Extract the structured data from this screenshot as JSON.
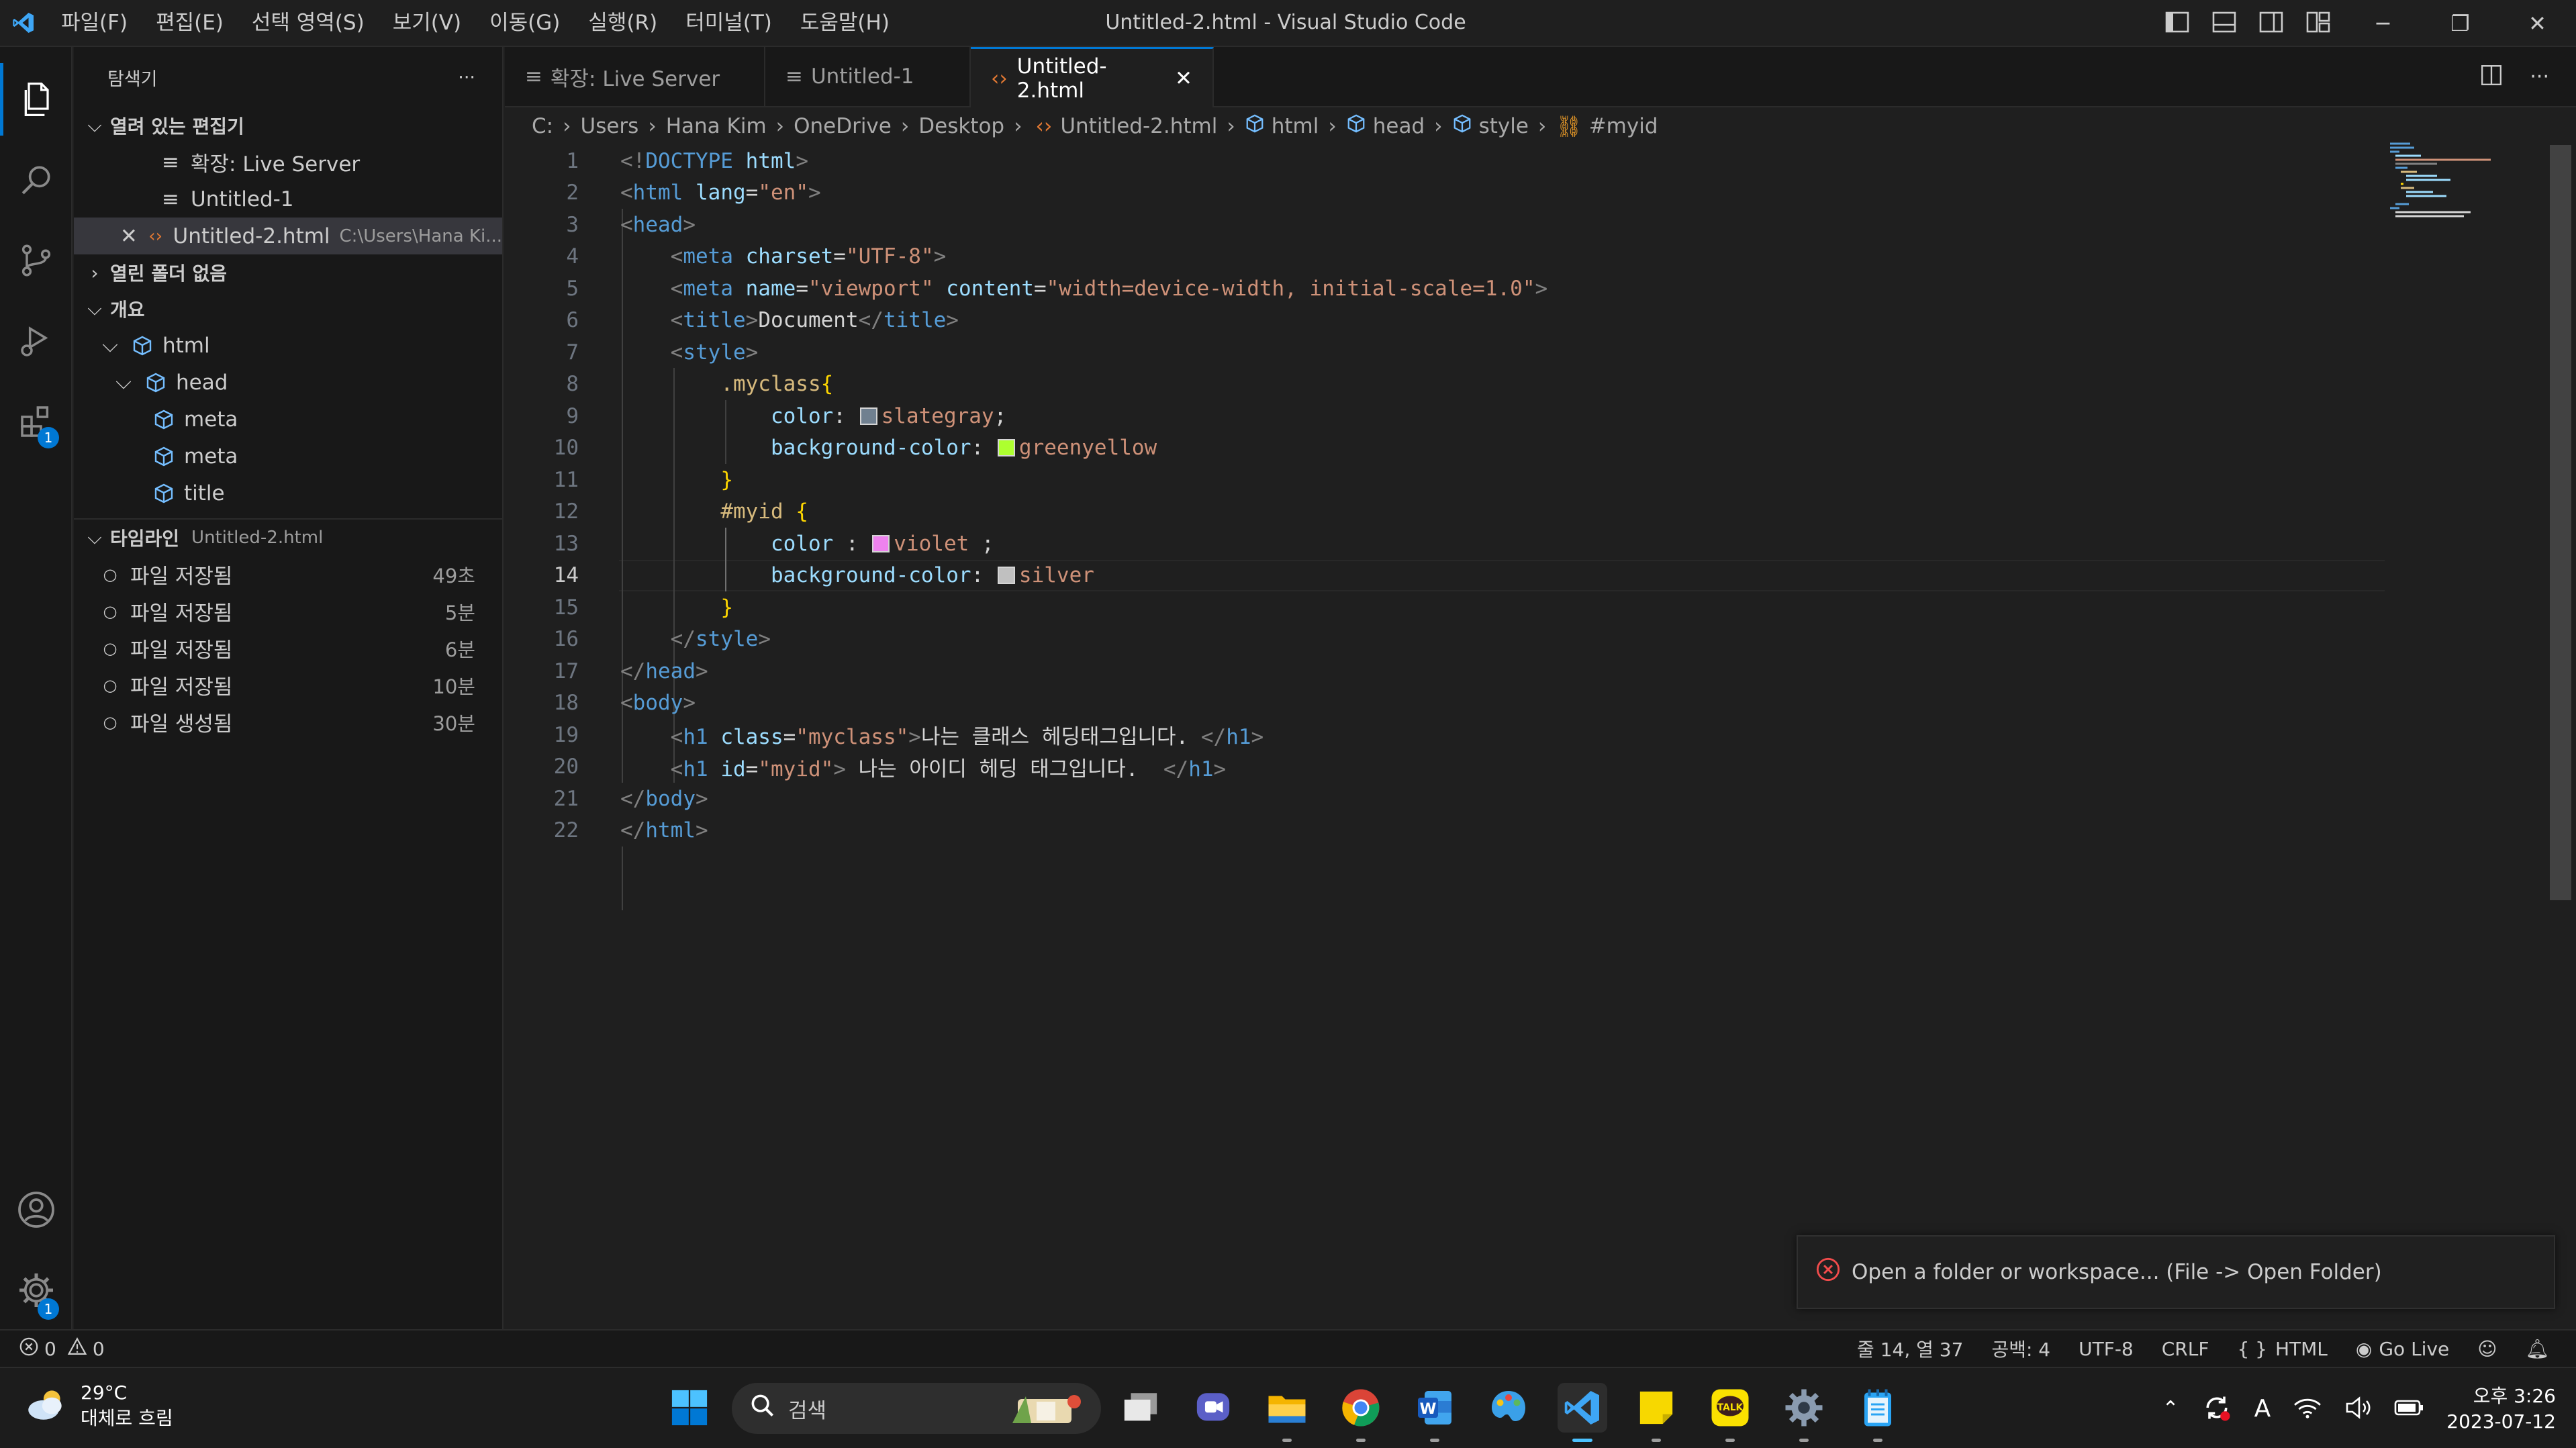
{
  "app": {
    "window_title": "Untitled-2.html - Visual Studio Code"
  },
  "menu": [
    "파일(F)",
    "편집(E)",
    "선택 영역(S)",
    "보기(V)",
    "이동(G)",
    "실행(R)",
    "터미널(T)",
    "도움말(H)"
  ],
  "activity": {
    "extensions_badge": "1",
    "manage_badge": "1"
  },
  "sidebar": {
    "title": "탐색기",
    "more": "···",
    "open_editors": {
      "header": "열려 있는 편집기",
      "items": [
        {
          "label": "확장: Live Server",
          "path": ""
        },
        {
          "label": "Untitled-1",
          "path": ""
        },
        {
          "label": "Untitled-2.html",
          "path": "C:\\Users\\Hana Ki..."
        }
      ]
    },
    "no_folder": "열린 폴더 없음",
    "outline": {
      "header": "개요",
      "items": [
        {
          "label": "html"
        },
        {
          "label": "head"
        },
        {
          "label": "meta"
        },
        {
          "label": "meta"
        },
        {
          "label": "title"
        }
      ]
    },
    "timeline": {
      "header": "타임라인",
      "file": "Untitled-2.html",
      "items": [
        {
          "label": "파일 저장됨",
          "time": "49초"
        },
        {
          "label": "파일 저장됨",
          "time": "5분"
        },
        {
          "label": "파일 저장됨",
          "time": "6분"
        },
        {
          "label": "파일 저장됨",
          "time": "10분"
        },
        {
          "label": "파일 생성됨",
          "time": "30분"
        }
      ]
    }
  },
  "tabs": [
    {
      "label": "확장: Live Server"
    },
    {
      "label": "Untitled-1"
    },
    {
      "label": "Untitled-2.html"
    }
  ],
  "breadcrumb": [
    "C:",
    "Users",
    "Hana Kim",
    "OneDrive",
    "Desktop",
    "Untitled-2.html",
    "html",
    "head",
    "style",
    "#myid"
  ],
  "code": {
    "line_numbers": [
      "1",
      "2",
      "3",
      "4",
      "5",
      "6",
      "7",
      "8",
      "9",
      "10",
      "11",
      "12",
      "13",
      "14",
      "15",
      "16",
      "17",
      "18",
      "19",
      "20",
      "21",
      "22"
    ],
    "current_line": "14",
    "l1": [
      "<!",
      "DOCTYPE",
      " html",
      ">"
    ],
    "l2": [
      "<",
      "html",
      " lang",
      "=",
      "\"en\"",
      ">"
    ],
    "l3": [
      "<",
      "head",
      ">"
    ],
    "l4": [
      "<",
      "meta",
      " charset",
      "=",
      "\"UTF-8\"",
      ">"
    ],
    "l5": [
      "<",
      "meta",
      " name",
      "=",
      "\"viewport\"",
      " content",
      "=",
      "\"width=device-width, initial-scale=1.0\"",
      ">"
    ],
    "l6": [
      "<",
      "title",
      ">",
      "Document",
      "</",
      "title",
      ">"
    ],
    "l7": [
      "<",
      "style",
      ">"
    ],
    "l8": [
      ".myclass",
      "{"
    ],
    "l9": [
      "color",
      ": ",
      "slategray",
      ";"
    ],
    "l10": [
      "background-color",
      ": ",
      "greenyellow"
    ],
    "l11": [
      "}"
    ],
    "l12": [
      "#myid",
      " {"
    ],
    "l13": [
      "color",
      " : ",
      "violet",
      " ;"
    ],
    "l14": [
      "background-color",
      ": ",
      "silver"
    ],
    "l15": [
      "}"
    ],
    "l16": [
      "</",
      "style",
      ">"
    ],
    "l17": [
      "</",
      "head",
      ">"
    ],
    "l18": [
      "<",
      "body",
      ">"
    ],
    "l19": [
      "<",
      "h1",
      " class",
      "=",
      "\"myclass\"",
      ">",
      "나는 클래스 헤딩태그입니다. ",
      "</",
      "h1",
      ">"
    ],
    "l20": [
      "<",
      "h1",
      " id",
      "=",
      "\"myid\"",
      ">",
      " 나는 아이디 헤딩 태그입니다.  ",
      "</",
      "h1",
      ">"
    ],
    "l21": [
      "</",
      "body",
      ">"
    ],
    "l22": [
      "</",
      "html",
      ">"
    ],
    "swatches": {
      "slategray": "#708090",
      "greenyellow": "#adff2f",
      "violet": "#ee82ee",
      "silver": "#c0c0c0"
    }
  },
  "notification": {
    "message": "Open a folder or workspace... (File -> Open Folder)"
  },
  "status": {
    "errors": "0",
    "warnings": "0",
    "position": "줄 14, 열 37",
    "spaces": "공백: 4",
    "encoding": "UTF-8",
    "eol": "CRLF",
    "language": "HTML",
    "golive": "Go Live"
  },
  "taskbar": {
    "temp": "29°C",
    "weather": "대체로 흐림",
    "search": "검색",
    "time": "오후 3:26",
    "date": "2023-07-12"
  },
  "colors": {
    "accent": "#0078d4",
    "error": "#f14c4c"
  }
}
